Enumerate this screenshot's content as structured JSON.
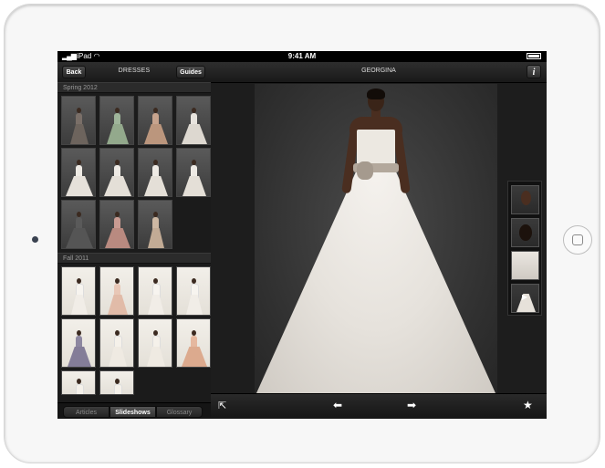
{
  "status_bar": {
    "carrier": "iPad",
    "time": "9:41 AM"
  },
  "left_panel": {
    "nav": {
      "back_label": "Back",
      "title": "DRESSES",
      "guides_label": "Guides"
    },
    "sections": [
      {
        "title": "Spring 2012",
        "thumbnail_count": 11
      },
      {
        "title": "Fall 2011",
        "thumbnail_count": 10
      }
    ],
    "tabs": [
      {
        "label": "Articles",
        "selected": false
      },
      {
        "label": "Slideshows",
        "selected": true
      },
      {
        "label": "Glossary",
        "selected": false
      }
    ]
  },
  "right_panel": {
    "nav": {
      "title": "GEORGINA",
      "info_icon": "info-icon"
    },
    "photo": {
      "subject": "GEORGINA"
    },
    "side_thumbnails": 4,
    "toolbar": {
      "icons": [
        "share-icon",
        "arrow-left-icon",
        "arrow-right-icon",
        "star-icon"
      ]
    }
  },
  "colors": {
    "screen_bg": "#1d1d1d",
    "bar_bg": "#2a2a2a",
    "text": "#ffffff"
  }
}
